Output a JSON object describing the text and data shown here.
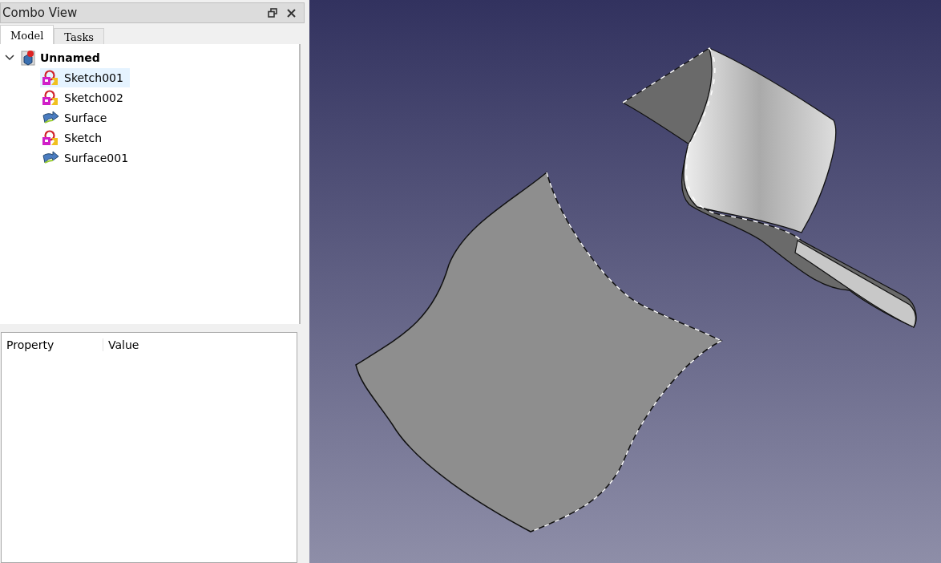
{
  "window": {
    "title": "Combo View"
  },
  "tabs": [
    {
      "label": "Model",
      "selected": true
    },
    {
      "label": "Tasks",
      "selected": false
    }
  ],
  "tree": {
    "label": "Unnamed",
    "kind": "document",
    "expanded": true,
    "children": [
      {
        "label": "Sketch001",
        "kind": "sketch",
        "selected": true
      },
      {
        "label": "Sketch002",
        "kind": "sketch",
        "selected": false
      },
      {
        "label": "Surface",
        "kind": "surface",
        "selected": false
      },
      {
        "label": "Sketch",
        "kind": "sketch",
        "selected": false
      },
      {
        "label": "Surface001",
        "kind": "surface",
        "selected": false
      }
    ]
  },
  "property_table": {
    "columns": [
      "Property",
      "Value"
    ]
  }
}
